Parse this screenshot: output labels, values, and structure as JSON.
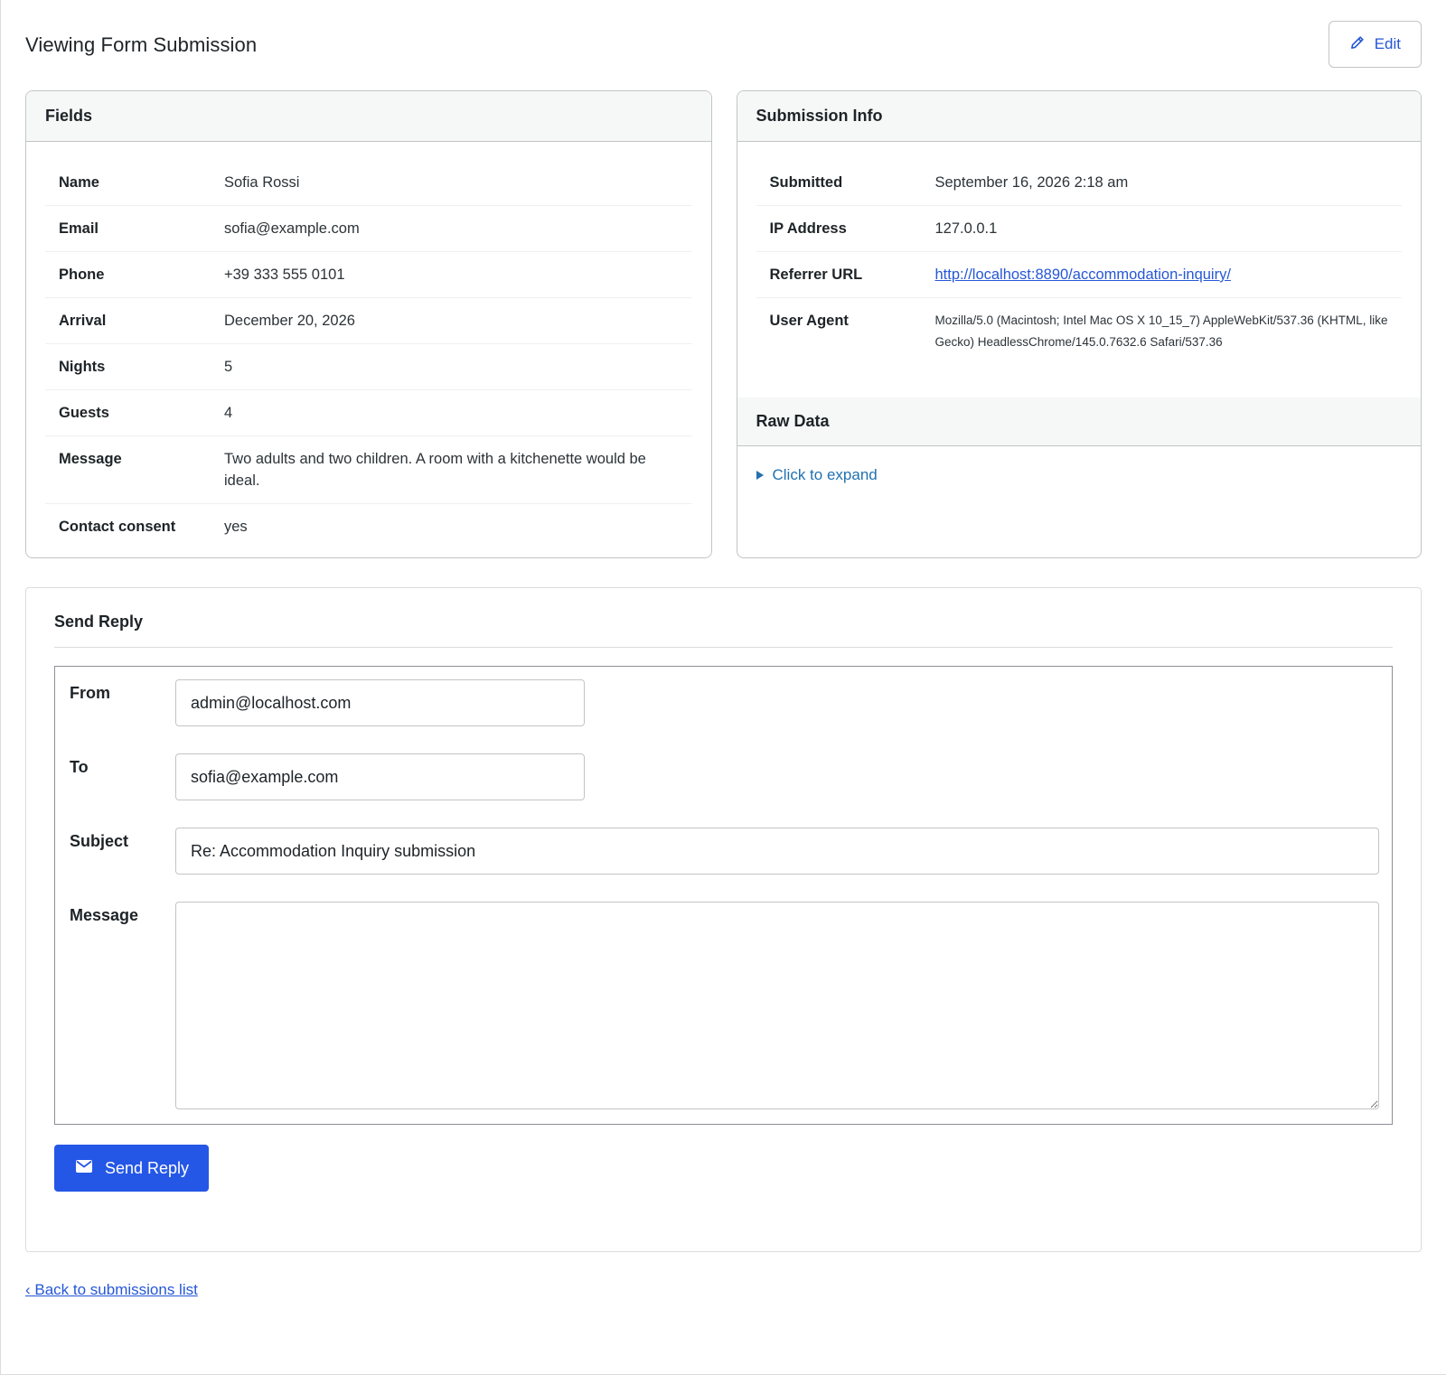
{
  "header": {
    "title": "Viewing Form Submission",
    "edit_label": "Edit"
  },
  "fields_panel": {
    "title": "Fields",
    "rows": [
      {
        "key": "Name",
        "value": "Sofia Rossi"
      },
      {
        "key": "Email",
        "value": "sofia@example.com"
      },
      {
        "key": "Phone",
        "value": "+39 333 555 0101"
      },
      {
        "key": "Arrival",
        "value": "December 20, 2026"
      },
      {
        "key": "Nights",
        "value": "5"
      },
      {
        "key": "Guests",
        "value": "4"
      },
      {
        "key": "Message",
        "value": "Two adults and two children. A room with a kitchenette would be ideal."
      },
      {
        "key": "Contact consent",
        "value": "yes"
      }
    ]
  },
  "info_panel": {
    "title": "Submission Info",
    "submitted_label": "Submitted",
    "submitted_value": "September 16, 2026 2:18 am",
    "ip_label": "IP Address",
    "ip_value": "127.0.0.1",
    "referrer_label": "Referrer URL",
    "referrer_value": "http://localhost:8890/accommodation-inquiry/",
    "agent_label": "User Agent",
    "agent_value": "Mozilla/5.0 (Macintosh; Intel Mac OS X 10_15_7) AppleWebKit/537.36 (KHTML, like Gecko) HeadlessChrome/145.0.7632.6 Safari/537.36",
    "raw_title": "Raw Data",
    "expand_label": "Click to expand"
  },
  "reply": {
    "title": "Send Reply",
    "from_label": "From",
    "from_value": "admin@localhost.com",
    "to_label": "To",
    "to_value": "sofia@example.com",
    "subject_label": "Subject",
    "subject_value": "Re: Accommodation Inquiry submission",
    "message_label": "Message",
    "message_value": "",
    "send_label": "Send Reply"
  },
  "footer": {
    "back_label": "‹ Back to submissions list"
  },
  "colors": {
    "accent": "#2557e6",
    "link": "#2557d6",
    "panel_header_bg": "#f6f7f7",
    "border": "#c3c4c7"
  }
}
